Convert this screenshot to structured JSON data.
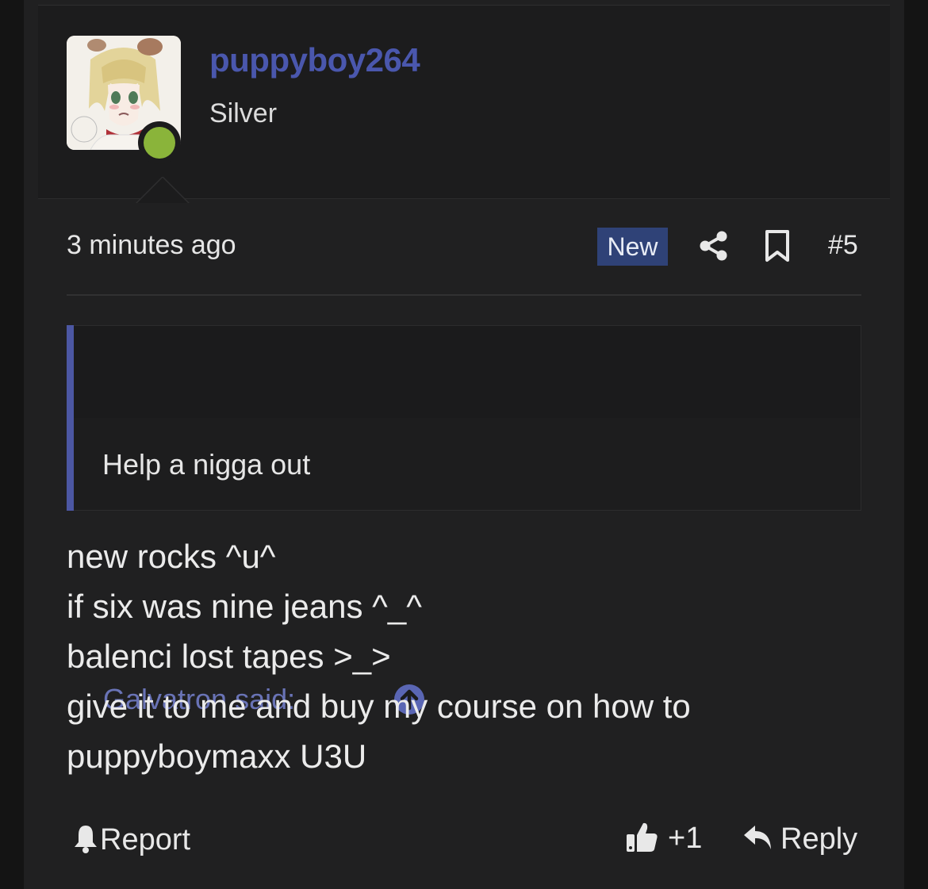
{
  "post": {
    "author": {
      "username": "puppyboy264",
      "title": "Silver",
      "online": true
    },
    "timestamp": "3 minutes ago",
    "badge": "New",
    "post_number": "#5",
    "quote": {
      "author_label": "Galvatron said:",
      "text": "Help a nigga out"
    },
    "body_lines": [
      "new rocks ^u^",
      "if six was nine jeans ^_^",
      "balenci lost tapes >_>",
      "give it to me and buy my course on how to",
      "puppyboymaxx U3U"
    ],
    "actions": {
      "report_label": "Report",
      "like_count": "+1",
      "reply_label": "Reply"
    }
  },
  "colors": {
    "accent": "#4a57ad",
    "badge_bg": "#2f4277",
    "online": "#8ab43a",
    "background": "#202021"
  },
  "icons": {
    "share": "share-icon",
    "bookmark": "bookmark-icon",
    "quote_jump": "arrow-up-circle-icon",
    "report": "bell-icon",
    "like": "thumbs-up-icon",
    "reply": "reply-icon"
  }
}
